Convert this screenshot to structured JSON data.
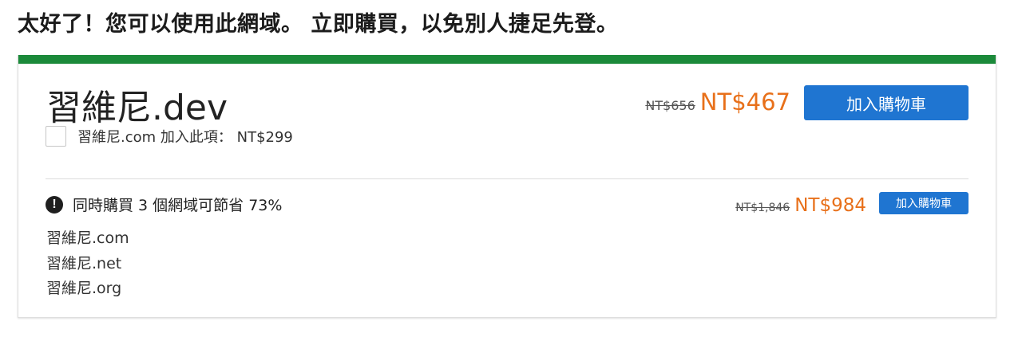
{
  "headline": "太好了！您可以使用此網域。 立即購買，以免別人捷足先登。",
  "colors": {
    "accent_bar": "#1b8a3a",
    "price_orange": "#e8701a",
    "button_blue": "#1f75d1"
  },
  "main_offer": {
    "domain": "習維尼.dev",
    "old_price": "NT$656",
    "new_price": "NT$467",
    "cart_button": "加入購物車",
    "addon": {
      "checked": false,
      "label": "習維尼.com 加入此項： NT$299"
    }
  },
  "bundle_offer": {
    "icon": "alert-circle-icon",
    "icon_glyph": "!",
    "title": "同時購買 3 個網域可節省 73%",
    "old_price": "NT$1,846",
    "new_price": "NT$984",
    "cart_button": "加入購物車",
    "domains": [
      "習維尼.com",
      "習維尼.net",
      "習維尼.org"
    ]
  }
}
